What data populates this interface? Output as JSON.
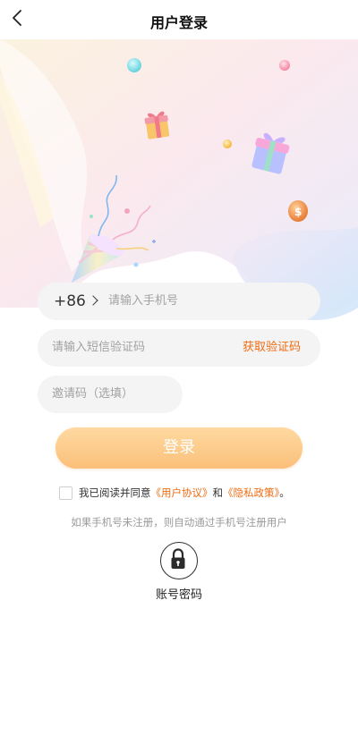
{
  "header": {
    "title": "用户登录",
    "back_icon": "chevron-left-icon"
  },
  "form": {
    "country_code": "+86",
    "phone_placeholder": "请输入手机号",
    "sms_placeholder": "请输入短信验证码",
    "get_code_label": "获取验证码",
    "invite_placeholder": "邀请码（选填）",
    "login_label": "登录"
  },
  "agreement": {
    "prefix": "我已阅读并同意",
    "user_agreement": "《用户协议》",
    "and": "和",
    "privacy_policy": "《隐私政策》",
    "suffix": "。",
    "checked": false
  },
  "hint": "如果手机号未注册，则自动通过手机号注册用户",
  "alt_login": {
    "label": "账号密码",
    "icon": "lock-icon"
  },
  "colors": {
    "accent": "#ef6c13",
    "button": "#fcca8a",
    "field_bg": "#f4f4f4"
  }
}
